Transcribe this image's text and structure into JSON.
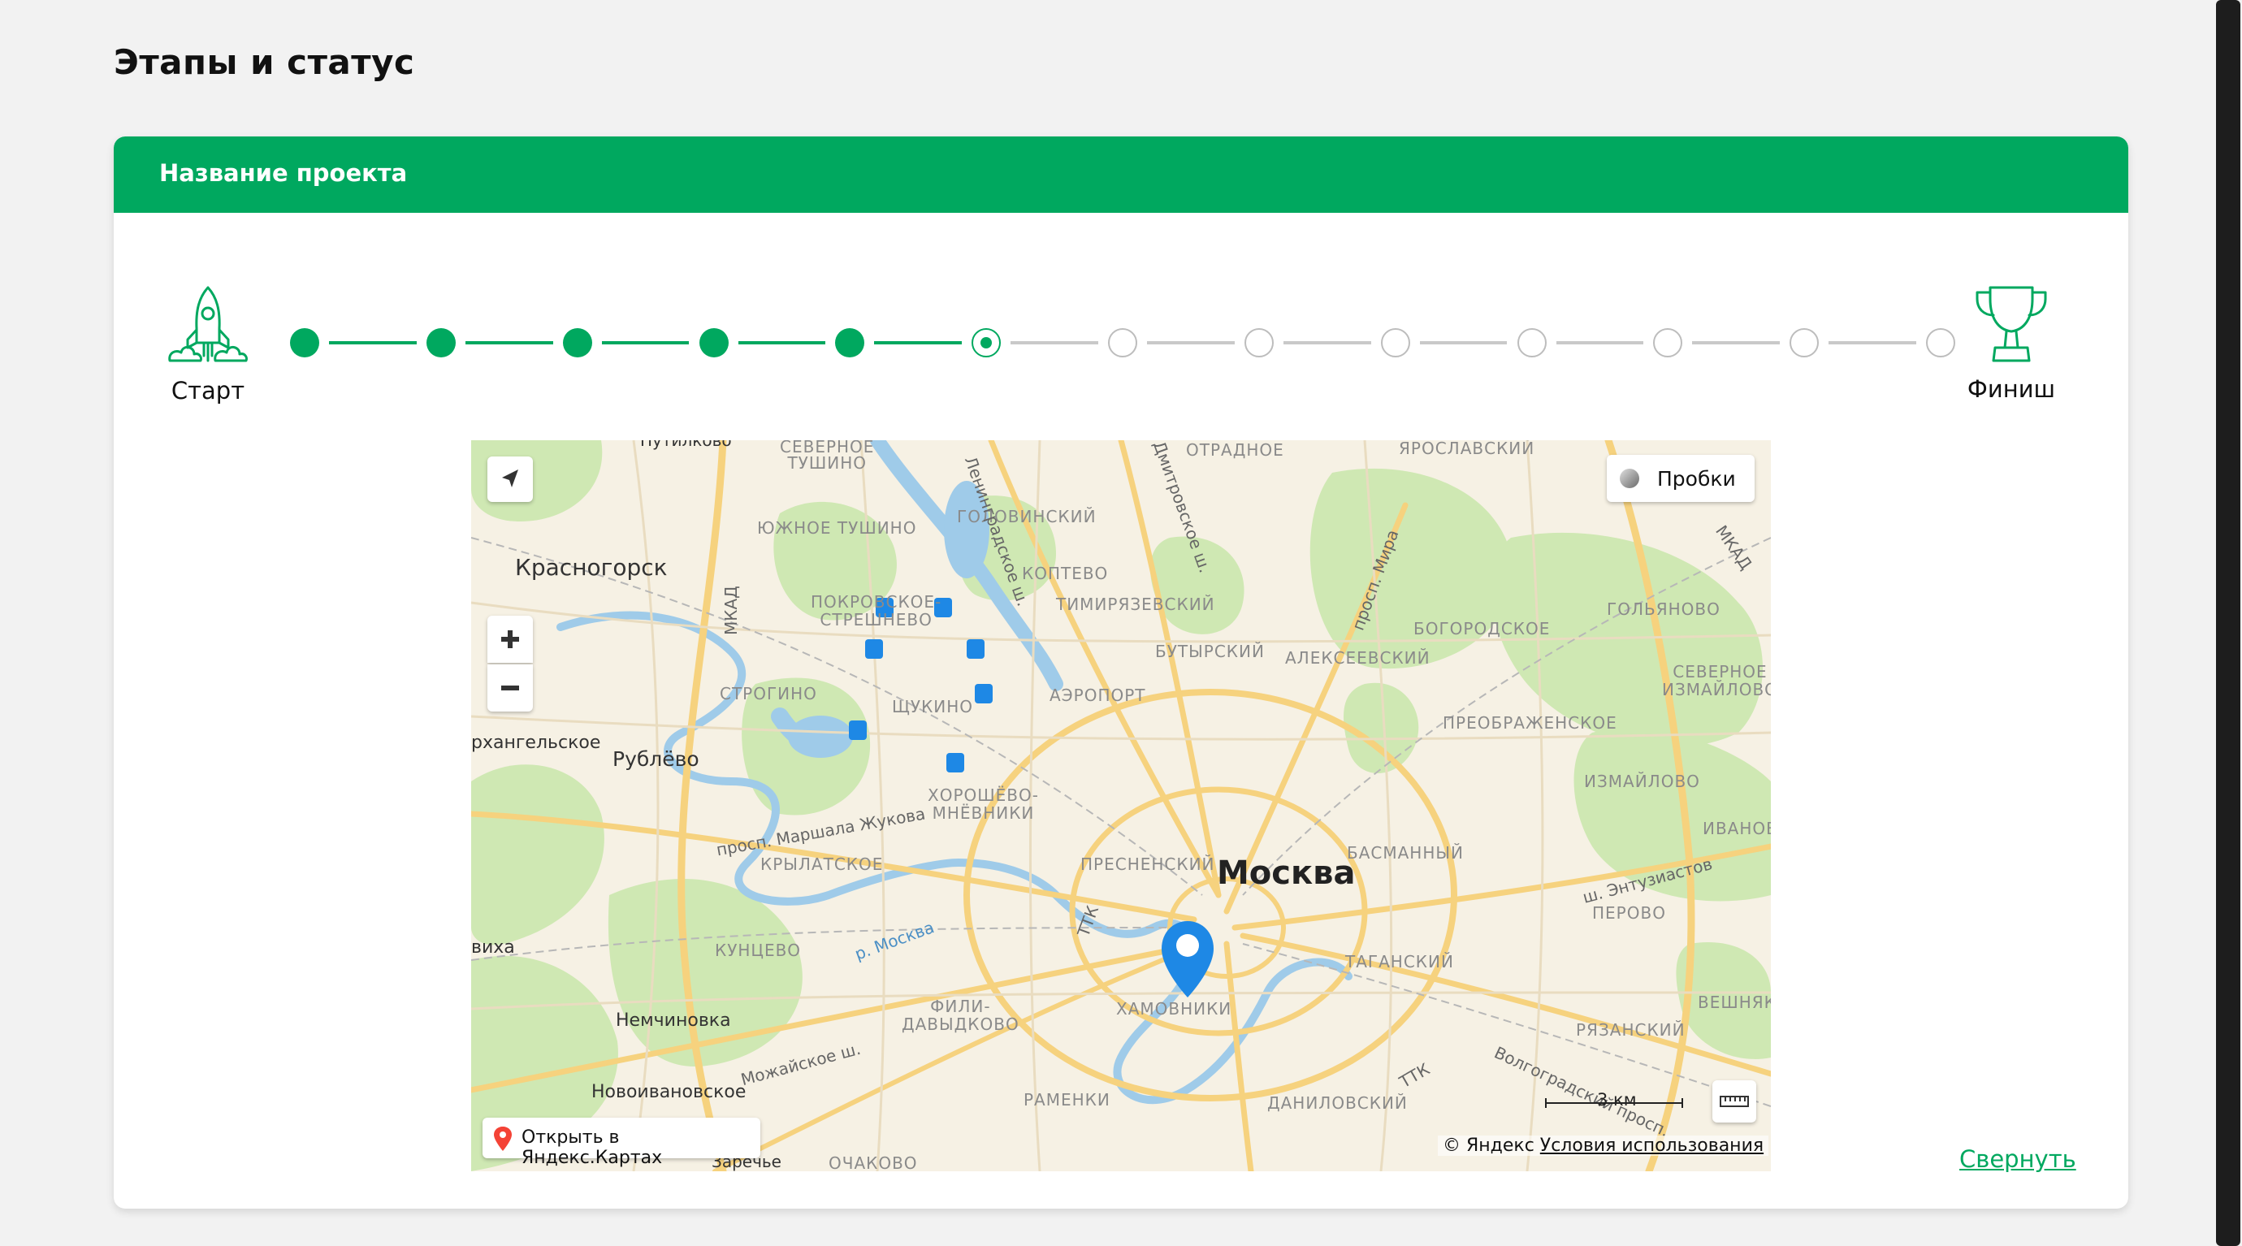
{
  "page": {
    "title": "Этапы и статус"
  },
  "project": {
    "title": "Название проекта",
    "start_label": "Старт",
    "finish_label": "Финиш",
    "stages": [
      {
        "status": "done"
      },
      {
        "status": "done"
      },
      {
        "status": "done"
      },
      {
        "status": "done"
      },
      {
        "status": "done"
      },
      {
        "status": "current"
      },
      {
        "status": "todo"
      },
      {
        "status": "todo"
      },
      {
        "status": "todo"
      },
      {
        "status": "todo"
      },
      {
        "status": "todo"
      },
      {
        "status": "todo"
      },
      {
        "status": "todo"
      }
    ],
    "collapse_label": "Свернуть"
  },
  "map": {
    "traffic_label": "Пробки",
    "open_label": "Открыть в Яндекс.Картах",
    "scale_label": "3 км",
    "copyright": "© Яндекс",
    "terms": "Условия использования",
    "labels": {
      "moscow": "Москва",
      "krasnogorsk": "Красногорск",
      "rublevo": "Рублёво",
      "arkhangelskoe": "рхангельское",
      "nemchinovka": "Немчиновка",
      "novoivanovskoe": "Новоивановское",
      "vikha": "виха",
      "zarechye": "Заречье",
      "putilkovo": "Путилково",
      "severnoe_tushino": "СЕВЕРНОЕ\nТУШИНО",
      "yuzhnoe_tushino": "ЮЖНОЕ ТУШИНО",
      "golovinsky": "ГОЛОВИНСКИЙ",
      "koptevo": "КОПТЕВО",
      "timiryazevsky": "ТИМИРЯЗЕВСКИЙ",
      "butyrsky": "БУТЫРСКИЙ",
      "alekseevsky": "АЛЕКСЕЕВСКИЙ",
      "otradnoe": "ОТРАДНОЕ",
      "yaroslavsky": "ЯРОСЛАВСКИЙ",
      "bogorodskoe": "БОГОРОДСКОЕ",
      "golyanovo": "ГОЛЬЯНОВО",
      "severnoe_izmaylovo": "СЕВЕРНОЕ\nИЗМАЙЛОВО",
      "preobrazhenskoe": "ПРЕОБРАЖЕНСКОЕ",
      "izmaylovo": "ИЗМАЙЛОВО",
      "ivanovskoe": "ИВАНОВ",
      "perovo": "ПЕРОВО",
      "basmanny": "БАСМАННЫЙ",
      "tagansky": "ТАГАНСКИЙ",
      "veshnyaki": "ВЕШНЯКИ",
      "ryazansky": "РЯЗАНСКИЙ",
      "danilovsky": "ДАНИЛОВСКИЙ",
      "ramenki": "РАМЕНКИ",
      "ochakovo": "ОЧАКОВО",
      "khamovniki": "ХАМОВНИКИ",
      "presnensky": "ПРЕСНЕНСКИЙ",
      "khoroshevo": "ХОРОШЁВО-\nМНЁВНИКИ",
      "krylatskoe": "КРЫЛАТСКОЕ",
      "kuntsevo": "КУНЦЕВО",
      "fili": "ФИЛИ-\nДАВЫДКОВО",
      "shchukino": "ЩУКИНО",
      "strogino": "СТРОГИНО",
      "pokrovskoe": "ПОКРОВСКОЕ-\nСТРЕШНЕВО",
      "aeroport": "АЭРОПОРТ",
      "mkad": "МКАД",
      "ttk": "ТТК",
      "pr_mira": "просп. Мира",
      "dmitrovskoe": "Дмитровское ш.",
      "leningradskoe": "Ленинградское ш.",
      "zhukova": "просп. Маршала Жукова",
      "mozhayskoe": "Можайское ш.",
      "entuziastov": "ш. Энтузиастов",
      "volgogradsky": "Волгоградский просп.",
      "river": "р. Москва"
    }
  },
  "colors": {
    "accent": "#00a85f",
    "todo": "#bdbdbd",
    "pin": "#1e88e5"
  }
}
